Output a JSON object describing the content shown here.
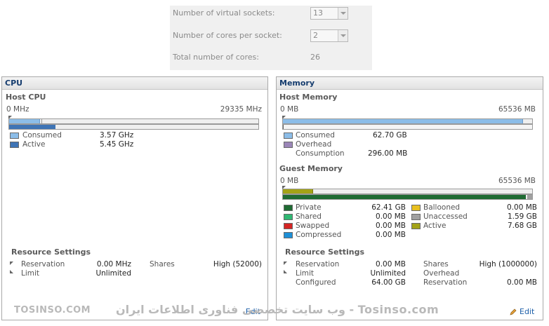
{
  "vm_config": {
    "sockets_label": "Number of virtual sockets:",
    "sockets_value": "13",
    "cores_label": "Number of cores per socket:",
    "cores_value": "2",
    "total_label": "Total number of cores:",
    "total_value": "26"
  },
  "cpu": {
    "title": "CPU",
    "host_title": "Host CPU",
    "min": "0 MHz",
    "max": "29335 MHz",
    "consumed_fraction": 0.122,
    "active_fraction": 0.186,
    "consumed_label": "Consumed",
    "consumed_value": "3.57 GHz",
    "active_label": "Active",
    "active_value": "5.45 GHz",
    "resource_title": "Resource Settings",
    "reservation_label": "Reservation",
    "reservation_value": "0.00 MHz",
    "limit_label": "Limit",
    "limit_value": "Unlimited",
    "shares_label": "Shares",
    "shares_value": "High (52000)",
    "colors": {
      "consumed": "#8cbde8",
      "active": "#3f74b5"
    }
  },
  "memory": {
    "title": "Memory",
    "host_title": "Host Memory",
    "min": "0 MB",
    "max": "65536 MB",
    "host_consumed_fraction": 0.96,
    "consumed_label": "Consumed",
    "consumed_value": "62.70 GB",
    "overhead_label": "Overhead",
    "consumption_label": "Consumption",
    "consumption_value": "296.00 MB",
    "guest_title": "Guest Memory",
    "guest_min": "0 MB",
    "guest_max": "65536 MB",
    "guest_active_fraction": 0.117,
    "guest_private_fraction": 0.975,
    "private_label": "Private",
    "private_value": "62.41 GB",
    "shared_label": "Shared",
    "shared_value": "0.00 MB",
    "swapped_label": "Swapped",
    "swapped_value": "0.00 MB",
    "compressed_label": "Compressed",
    "compressed_value": "0.00 MB",
    "ballooned_label": "Ballooned",
    "ballooned_value": "0.00 MB",
    "unaccessed_label": "Unaccessed",
    "unaccessed_value": "1.59 GB",
    "active_label": "Active",
    "active_value": "7.68 GB",
    "resource_title": "Resource Settings",
    "reservation_label": "Reservation",
    "reservation_value": "0.00 MB",
    "limit_label": "Limit",
    "limit_value": "Unlimited",
    "configured_label": "Configured",
    "configured_value": "64.00 GB",
    "shares_label": "Shares",
    "shares_value": "High (1000000)",
    "overhead_r_label": "Overhead",
    "reservation_r_label": "Reservation",
    "reservation_r_value": "0.00 MB",
    "edit_label": "Edit",
    "colors": {
      "consumed": "#8cbde8",
      "overhead": "#9b86b8",
      "private": "#1f6b33",
      "shared": "#2fb873",
      "swapped": "#d42424",
      "compressed": "#1e8fd6",
      "ballooned": "#e8c020",
      "unaccessed": "#a0a0a0",
      "active": "#a3a317"
    }
  },
  "cpu_edit_label": "Edit",
  "watermark": {
    "left": "TOSINSO.COM",
    "center": "وب سایت تخصصی فناوری اطلاعات ایران - Tosinso.com"
  }
}
